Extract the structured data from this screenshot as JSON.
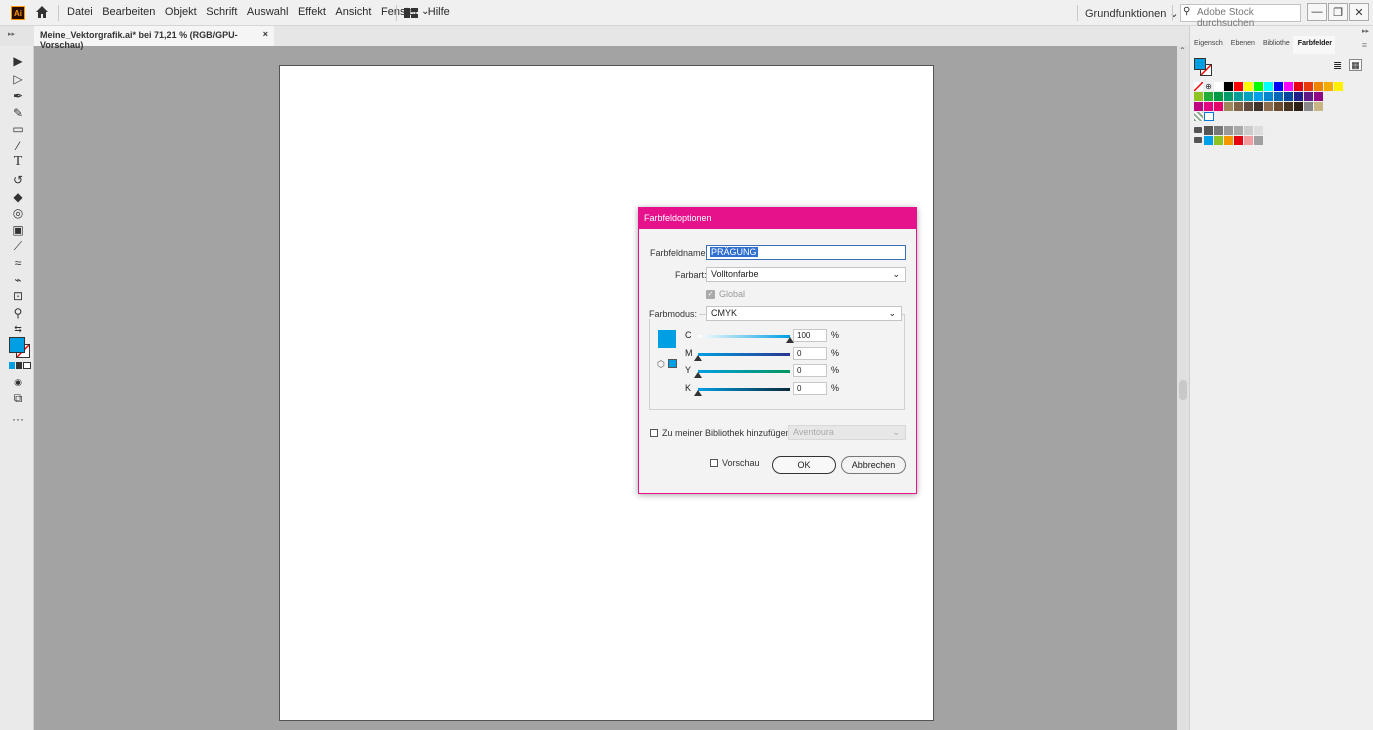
{
  "app": {
    "logo_text": "Ai"
  },
  "menu": [
    "Datei",
    "Bearbeiten",
    "Objekt",
    "Schrift",
    "Auswahl",
    "Effekt",
    "Ansicht",
    "Fenster",
    "Hilfe"
  ],
  "workspace": {
    "label": "Grundfunktionen",
    "chev": "⌄"
  },
  "search": {
    "placeholder": "Adobe Stock durchsuchen"
  },
  "window": {
    "minimize": "—",
    "restore": "❐",
    "close": "✕"
  },
  "document_tab": {
    "title": "Meine_Vektorgrafik.ai* bei 71,21 % (RGB/GPU-Vorschau)",
    "close": "×"
  },
  "panel_tabs": [
    {
      "label": "Eigensch",
      "active": false
    },
    {
      "label": "Ebenen",
      "active": false
    },
    {
      "label": "Bibliothe",
      "active": false
    },
    {
      "label": "Farbfelder",
      "active": true
    }
  ],
  "colors": {
    "accent": "#e6128c",
    "fill": "#009fe3",
    "swatch_rows": [
      [
        "#ffffff",
        "#000000",
        "#ff0000",
        "#ffff00",
        "#00ff00",
        "#00ffff",
        "#0000ff",
        "#ff00ff",
        "#e50012",
        "#e8380d",
        "#f08300",
        "#f6ab00",
        "#fff100"
      ],
      [
        "#8fc31f",
        "#22ac38",
        "#009944",
        "#009b6b",
        "#009e96",
        "#00a0c1",
        "#00a0e9",
        "#0086d1",
        "#0068b7",
        "#00479d",
        "#1d2088",
        "#601986",
        "#920783"
      ],
      [
        "#be0081",
        "#e4007f",
        "#e5006a",
        "#a0875a",
        "#7f6344",
        "#5f4a3c",
        "#42342b",
        "#8b6d4e",
        "#6b4b2e",
        "#45321f",
        "#2c1e14",
        "#888888",
        "#c9b483"
      ],
      [
        "#555555",
        "#777777",
        "#999999",
        "#aaaaaa",
        "#cccccc",
        "#dddddd",
        "#eeeeee"
      ],
      [
        "#00a0e9",
        "#8fc31f",
        "#f39800",
        "#e60012",
        "#f29c9f",
        "#a0a0a0"
      ]
    ]
  },
  "dialog": {
    "title": "Farbfeldoptionen",
    "name_label": "Farbfeldname:",
    "name_value": "PRÄGUNG",
    "type_label": "Farbart:",
    "type_value": "Volltonfarbe",
    "global_label": "Global",
    "mode_label": "Farbmodus:",
    "mode_value": "CMYK",
    "channels": [
      {
        "key": "C",
        "value": "100",
        "fraction": 1.0,
        "color_from": "#ffffff",
        "color_to": "#009fe3"
      },
      {
        "key": "M",
        "value": "0",
        "fraction": 0.0,
        "color_from": "#009fe3",
        "color_to": "#2a3590"
      },
      {
        "key": "Y",
        "value": "0",
        "fraction": 0.0,
        "color_from": "#009fe3",
        "color_to": "#00965e"
      },
      {
        "key": "K",
        "value": "0",
        "fraction": 0.0,
        "color_from": "#009fe3",
        "color_to": "#0a2a3a"
      }
    ],
    "percent": "%",
    "library_label": "Zu meiner Bibliothek hinzufügen",
    "library_value": "Aventoura",
    "preview_label": "Vorschau",
    "ok_label": "OK",
    "cancel_label": "Abbrechen"
  }
}
